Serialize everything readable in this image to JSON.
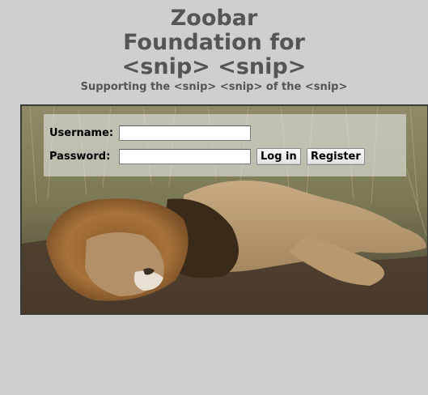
{
  "header": {
    "title_line1": "Zoobar",
    "title_line2": "Foundation for",
    "title_line3": "<snip> <snip>",
    "subtitle": "Supporting the <snip> <snip> of the <snip>"
  },
  "login": {
    "username_label": "Username:",
    "username_value": "",
    "password_label": "Password:",
    "password_value": "",
    "login_button": "Log in",
    "register_button": "Register"
  },
  "image": {
    "subject": "sleeping lion on grass"
  },
  "colors": {
    "background": "#cfcfcf",
    "title_text": "#555555",
    "panel": "rgba(235,235,235,0.58)"
  }
}
